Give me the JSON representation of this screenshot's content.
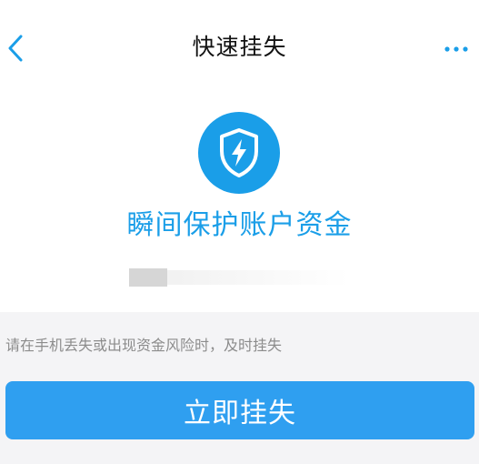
{
  "header": {
    "title": "快速挂失",
    "back_icon": "chevron-left-icon",
    "more_icon": "more-horizontal-icon"
  },
  "hero": {
    "icon": "shield-lightning-icon",
    "tagline": "瞬间保护账户资金"
  },
  "hint": {
    "text": "请在手机丢失或出现资金风险时，及时挂失"
  },
  "action": {
    "button_label": "立即挂失"
  },
  "colors": {
    "accent": "#1a9ee8",
    "button": "#2f9ff0",
    "background": "#f4f4f6"
  }
}
